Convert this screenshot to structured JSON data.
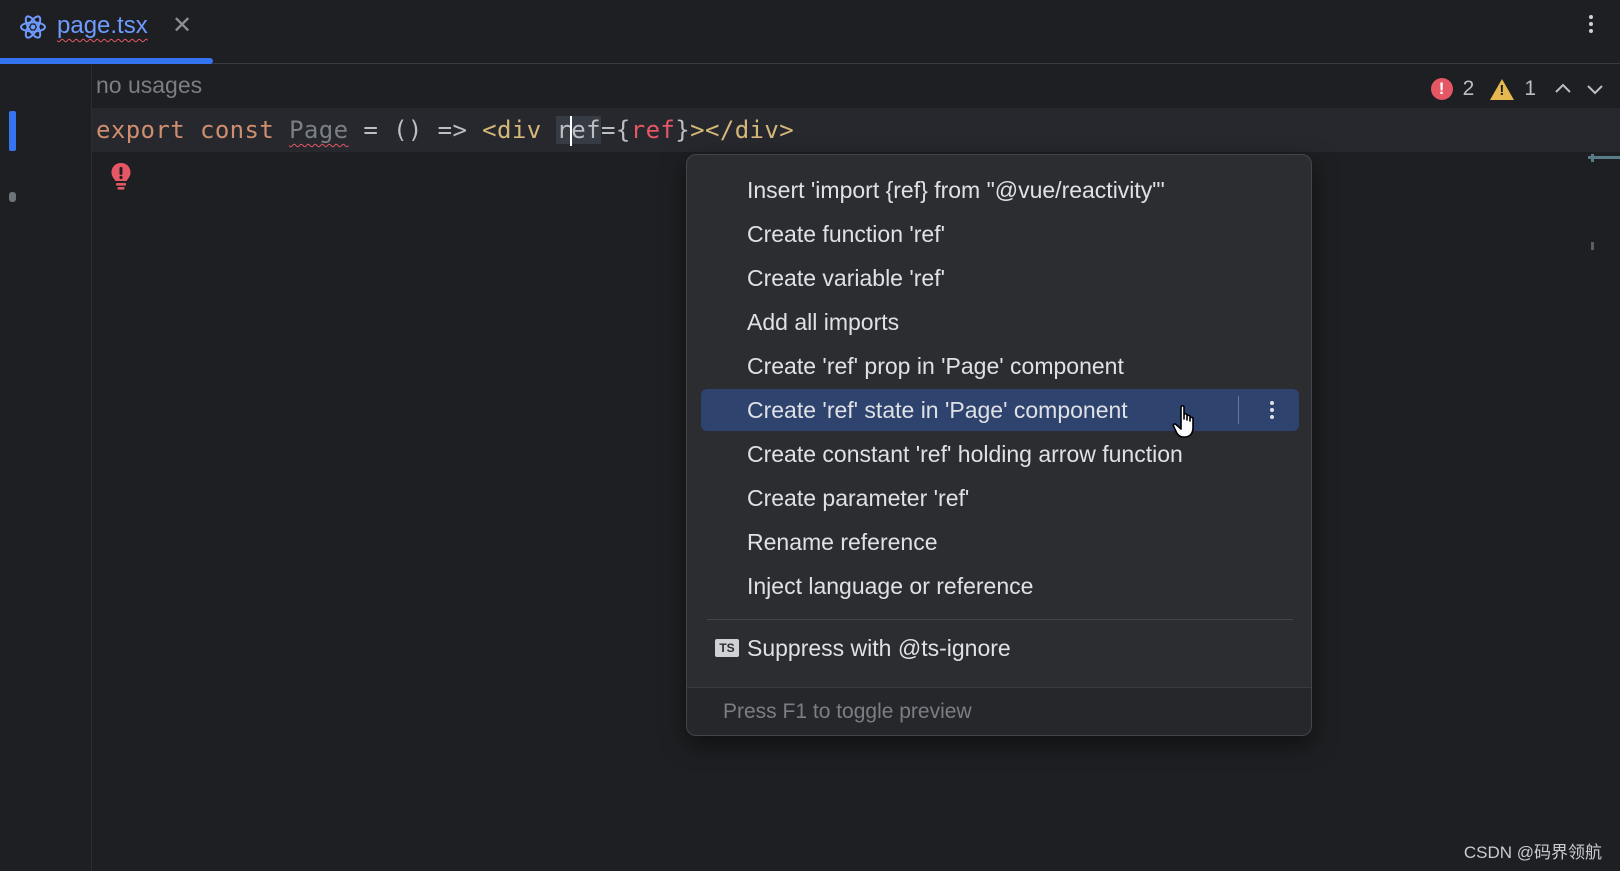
{
  "tab": {
    "filename": "page.tsx",
    "close_glyph": "✕",
    "icon": "react-icon"
  },
  "editor": {
    "inlay_hint": "no usages",
    "code_line": {
      "kw_export": "export",
      "kw_const": "const",
      "identifier": "Page",
      "eq": "=",
      "arrow_fn": "() =>",
      "tag_open": "<div",
      "attr_first": "r",
      "attr_rest": "ef",
      "attr_eq": "=",
      "brace_open": "{",
      "ref_value": "ref",
      "brace_close": "}",
      "tag_close": "></div>"
    }
  },
  "inspections": {
    "errors": "2",
    "warnings": "1",
    "error_icon": "error-icon",
    "warning_icon": "warning-icon"
  },
  "popup": {
    "items": [
      {
        "label": "Insert 'import {ref} from \"@vue/reactivity\"'"
      },
      {
        "label": "Create function 'ref'"
      },
      {
        "label": "Create variable 'ref'"
      },
      {
        "label": "Add all imports"
      },
      {
        "label": "Create 'ref' prop in 'Page' component"
      },
      {
        "label": "Create 'ref' state in 'Page' component",
        "selected": true
      },
      {
        "label": "Create constant 'ref' holding arrow function"
      },
      {
        "label": "Create parameter 'ref'"
      },
      {
        "label": "Rename reference"
      },
      {
        "label": "Inject language or reference"
      }
    ],
    "suppress": {
      "label": "Suppress with @ts-ignore",
      "icon_text": "TS"
    },
    "footer": "Press F1 to toggle preview"
  },
  "colors": {
    "accent": "#3574f0",
    "selection": "#2e436e",
    "error": "#e55765",
    "warning": "#e5b94f"
  },
  "watermark": "CSDN @码界领航"
}
